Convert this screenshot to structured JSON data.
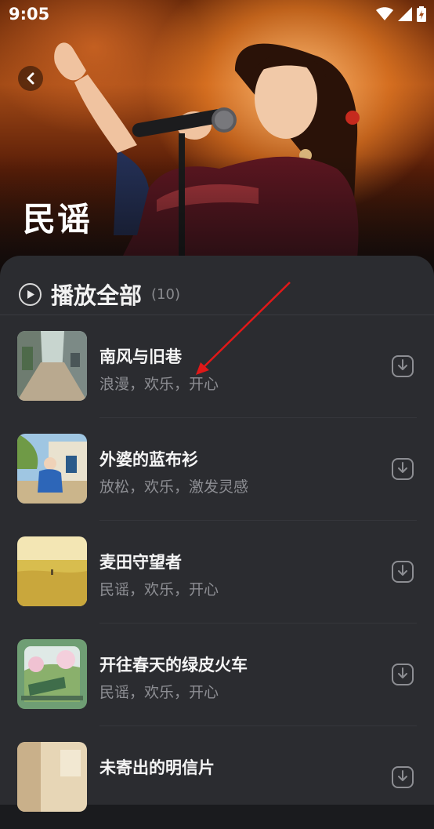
{
  "status_bar": {
    "time": "9:05"
  },
  "header": {
    "title": "民谣"
  },
  "play_all": {
    "label": "播放全部",
    "count": "(10)"
  },
  "songs": [
    {
      "title": "南风与旧巷",
      "tags": "浪漫，欢乐，开心",
      "cover": "alley-cover"
    },
    {
      "title": "外婆的蓝布衫",
      "tags": "放松，欢乐，激发灵感",
      "cover": "grandma-cover"
    },
    {
      "title": "麦田守望者",
      "tags": "民谣，欢乐，开心",
      "cover": "wheatfield-cover"
    },
    {
      "title": "开往春天的绿皮火车",
      "tags": "民谣，欢乐，开心",
      "cover": "train-cover"
    },
    {
      "title": "未寄出的明信片",
      "tags": "",
      "cover": "postcard-cover"
    }
  ],
  "colors": {
    "sheet": "#2b2c30",
    "text_secondary": "#8d8e93",
    "annotation_arrow": "#e01818"
  }
}
